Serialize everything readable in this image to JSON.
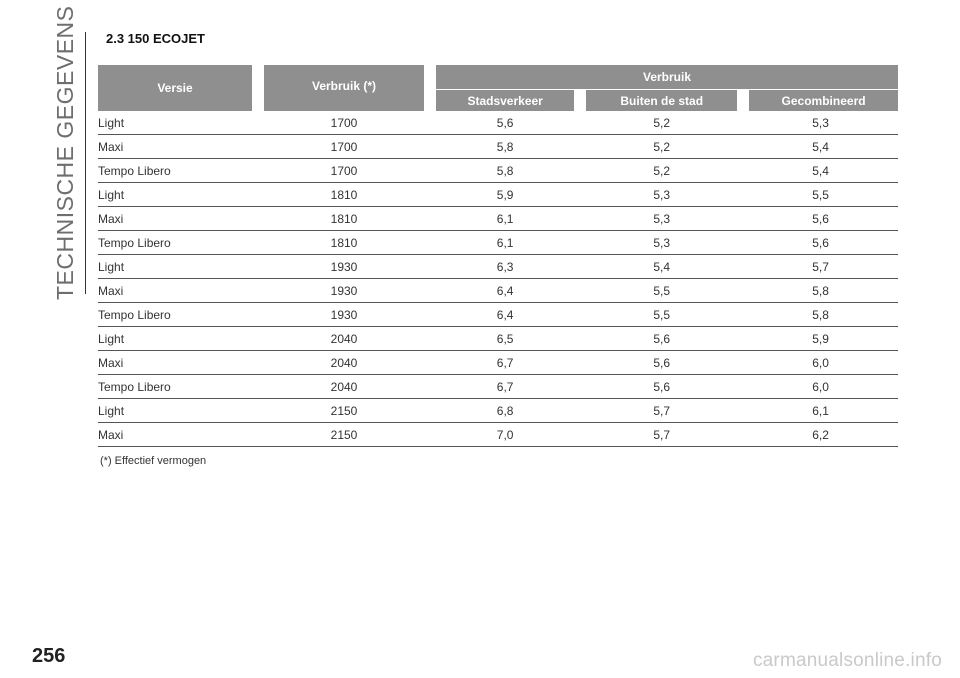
{
  "sidebar": {
    "section_title": "TECHNISCHE GEGEVENS"
  },
  "section": {
    "title": "2.3 150 ECOJET"
  },
  "table": {
    "headers": {
      "versie": "Versie",
      "verbruik_unit": "Verbruik (*)",
      "verbruik_group": "Verbruik",
      "stadsverkeer": "Stadsverkeer",
      "buiten_de_stad": "Buiten de stad",
      "gecombineerd": "Gecombineerd"
    },
    "rows": [
      [
        "Light",
        "1700",
        "5,6",
        "5,2",
        "5,3"
      ],
      [
        "Maxi",
        "1700",
        "5,8",
        "5,2",
        "5,4"
      ],
      [
        "Tempo Libero",
        "1700",
        "5,8",
        "5,2",
        "5,4"
      ],
      [
        "Light",
        "1810",
        "5,9",
        "5,3",
        "5,5"
      ],
      [
        "Maxi",
        "1810",
        "6,1",
        "5,3",
        "5,6"
      ],
      [
        "Tempo Libero",
        "1810",
        "6,1",
        "5,3",
        "5,6"
      ],
      [
        "Light",
        "1930",
        "6,3",
        "5,4",
        "5,7"
      ],
      [
        "Maxi",
        "1930",
        "6,4",
        "5,5",
        "5,8"
      ],
      [
        "Tempo Libero",
        "1930",
        "6,4",
        "5,5",
        "5,8"
      ],
      [
        "Light",
        "2040",
        "6,5",
        "5,6",
        "5,9"
      ],
      [
        "Maxi",
        "2040",
        "6,7",
        "5,6",
        "6,0"
      ],
      [
        "Tempo Libero",
        "2040",
        "6,7",
        "5,6",
        "6,0"
      ],
      [
        "Light",
        "2150",
        "6,8",
        "5,7",
        "6,1"
      ],
      [
        "Maxi",
        "2150",
        "7,0",
        "5,7",
        "6,2"
      ]
    ]
  },
  "footnote": "(*) Effectief vermogen",
  "page_number": "256",
  "watermark": "carmanualsonline.info"
}
